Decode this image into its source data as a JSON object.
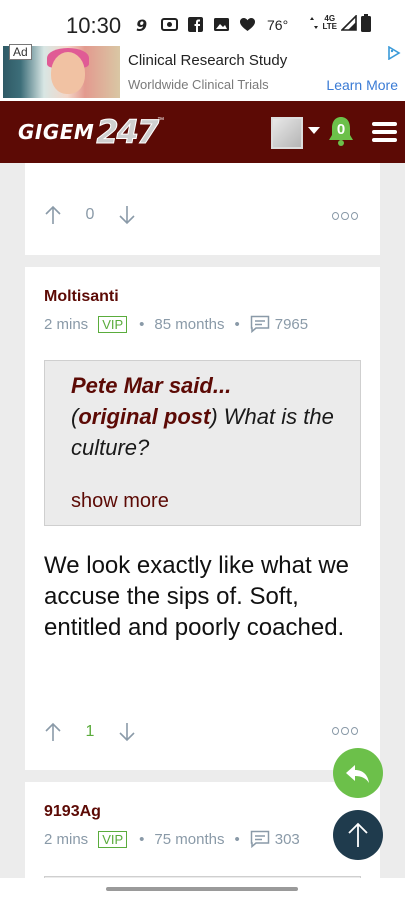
{
  "status_bar": {
    "time": "10:30",
    "temperature": "76°",
    "network": "4G",
    "network_sub": "LTE",
    "icons": [
      "nine-icon",
      "radio-icon",
      "facebook-icon",
      "image-icon",
      "heart-icon",
      "wifi-icon",
      "signal-icon",
      "battery-icon"
    ]
  },
  "ad": {
    "badge": "Ad",
    "title": "Clinical Research Study",
    "sponsor": "Worldwide Clinical Trials",
    "cta": "Learn More"
  },
  "header": {
    "logo_word": "GIGEM",
    "logo_number": "247",
    "logo_tm": "™",
    "notification_count": "0",
    "colors": {
      "brand": "#5c0a05",
      "bell": "#6cc04a"
    }
  },
  "card1": {
    "vote_count": "0"
  },
  "card2": {
    "username": "Moltisanti",
    "time": "2 mins",
    "badge": "VIP",
    "tenure": "85 months",
    "post_count": "7965",
    "quote_author": "Pete Mar said...",
    "quote_open": "(",
    "quote_link": "original post",
    "quote_close": ")",
    "quote_text": " What is the culture?",
    "show_more": "show more",
    "body": "We look exactly like what we accuse the sips of. Soft, entitled and poorly coached.",
    "vote_count": "1"
  },
  "card3": {
    "username": "9193Ag",
    "time": "2 mins",
    "badge": "VIP",
    "tenure": "75 months",
    "post_count": "303"
  },
  "separator": "•"
}
